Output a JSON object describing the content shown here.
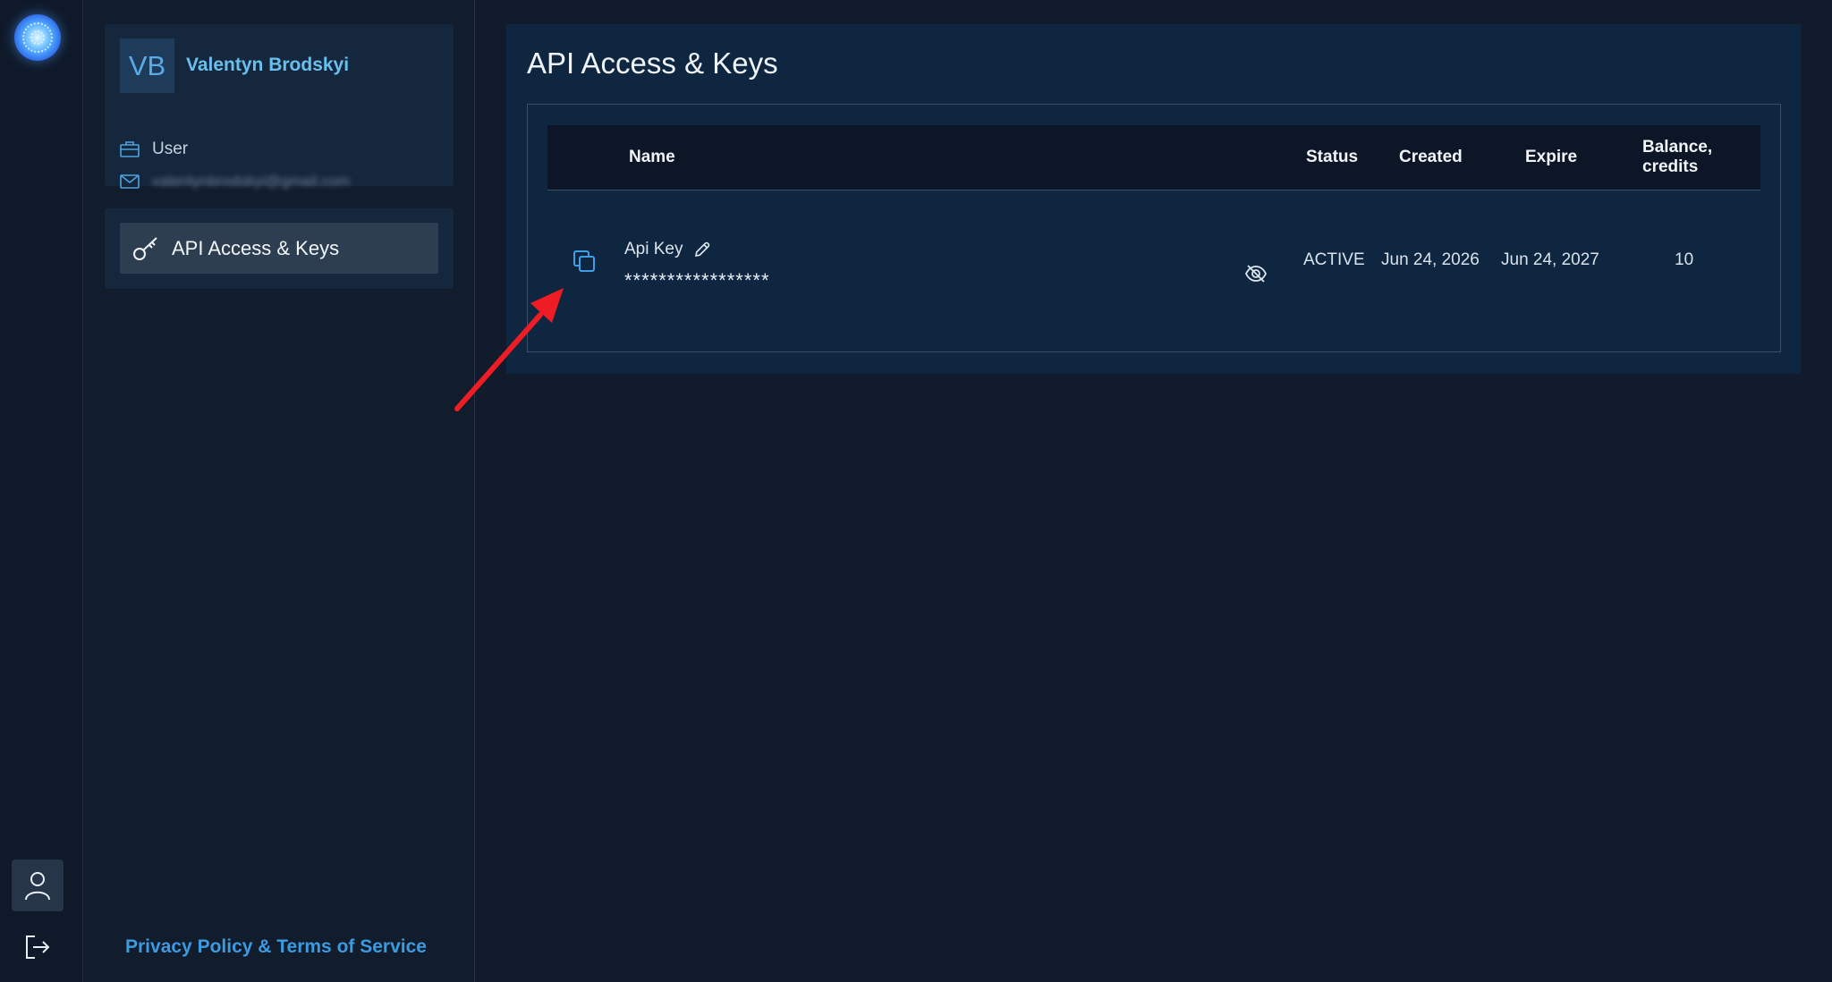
{
  "user": {
    "initials": "VB",
    "name": "Valentyn Brodskyi",
    "role": "User",
    "email": "valentynbrodskyi@gmail.com"
  },
  "nav": {
    "items": [
      {
        "label": "API Access & Keys",
        "icon": "key-icon",
        "active": true
      }
    ]
  },
  "footer": {
    "link": "Privacy Policy & Terms of Service"
  },
  "main": {
    "title": "API Access & Keys",
    "columns": [
      "Name",
      "Status",
      "Created",
      "Expire",
      "Balance, credits"
    ],
    "rows": [
      {
        "name": "Api Key",
        "masked_key": "*****************",
        "status": "ACTIVE",
        "created": "Jun 24, 2026",
        "expire": "Jun 24, 2027",
        "balance": "10"
      }
    ]
  },
  "colors": {
    "accent": "#3c9ae0",
    "annotation_arrow": "#ee1c24"
  },
  "icons": [
    "logo-icon",
    "user-icon",
    "logout-icon",
    "briefcase-icon",
    "mail-icon",
    "key-icon",
    "copy-icon",
    "pencil-icon",
    "eye-off-icon"
  ]
}
